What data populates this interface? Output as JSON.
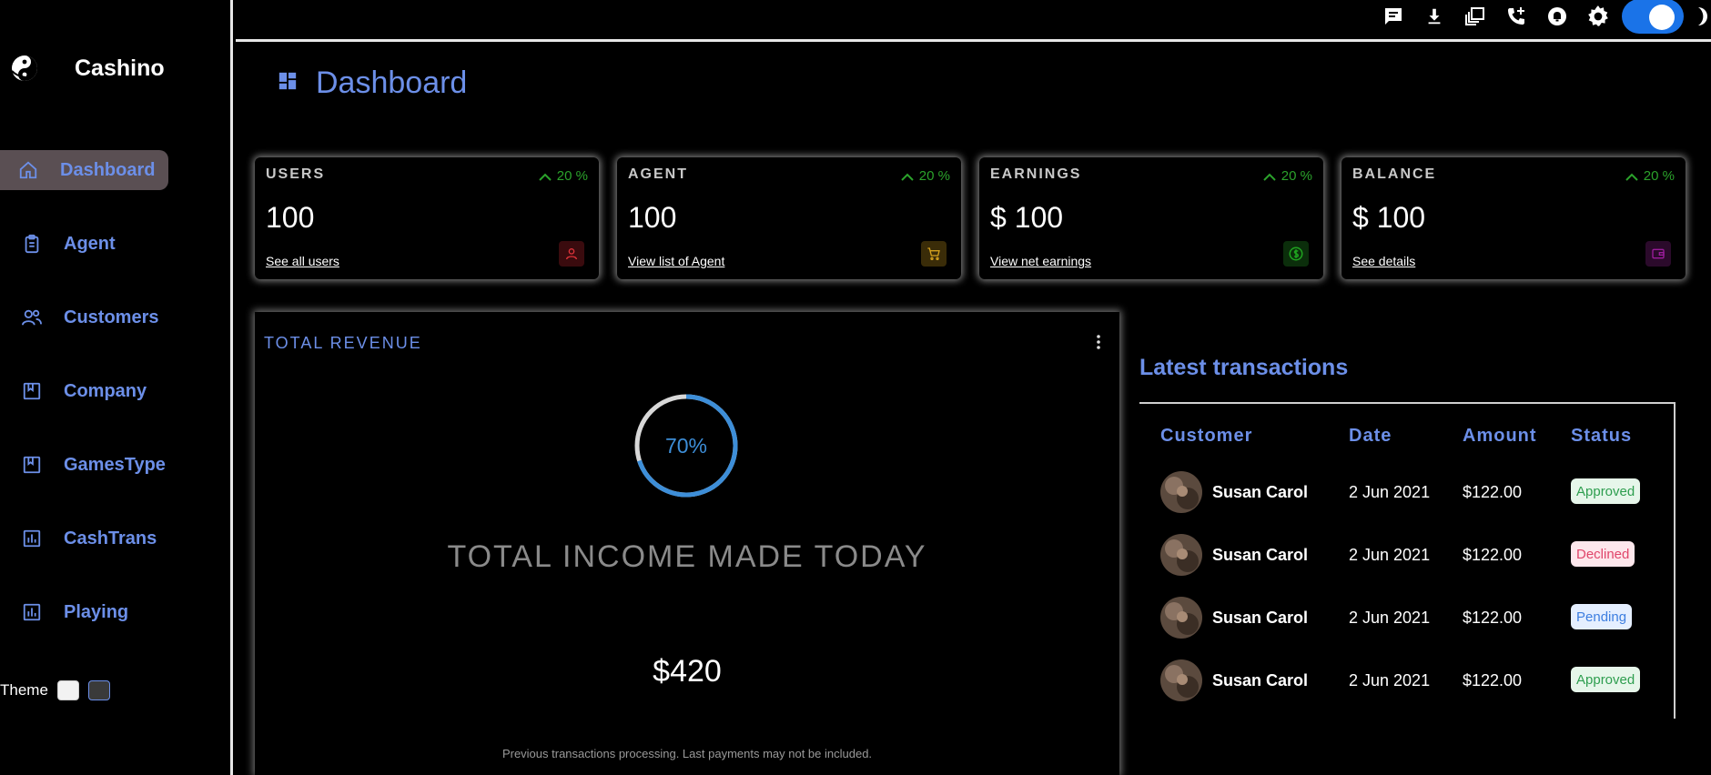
{
  "app": {
    "logo_text": "Cashino"
  },
  "sidebar": {
    "items": [
      {
        "label": "Dashboard",
        "icon": "home-icon"
      },
      {
        "label": "Agent",
        "icon": "clipboard-icon"
      },
      {
        "label": "Customers",
        "icon": "users-icon"
      },
      {
        "label": "Company",
        "icon": "bookmark-icon"
      },
      {
        "label": "GamesType",
        "icon": "bookmark-icon"
      },
      {
        "label": "CashTrans",
        "icon": "bar-chart-icon"
      },
      {
        "label": "Playing",
        "icon": "bar-chart-icon"
      }
    ],
    "theme_label": "Theme",
    "theme_swatches": [
      "#f2f2f2",
      "#3a3a3a"
    ]
  },
  "topbar": {
    "icons": [
      "chat-icon",
      "download-icon",
      "copy-icon",
      "add-call-icon",
      "notification-icon",
      "settings-icon"
    ],
    "toggle_on": true
  },
  "page": {
    "title": "Dashboard"
  },
  "cards": [
    {
      "title": "USERS",
      "trend": "20 %",
      "value": "100",
      "link": "See all users",
      "badge_icon": "person-icon",
      "badge_color": "#e0333a"
    },
    {
      "title": "AGENT",
      "trend": "20 %",
      "value": "100",
      "link": "View list of Agent",
      "badge_icon": "cart-icon",
      "badge_color": "#d4a11e"
    },
    {
      "title": "EARNINGS",
      "trend": "20 %",
      "value": "$ 100",
      "link": "View net earnings",
      "badge_icon": "dollar-icon",
      "badge_color": "#1fa31f"
    },
    {
      "title": "BALANCE",
      "trend": "20 %",
      "value": "$ 100",
      "link": "See details",
      "badge_icon": "wallet-icon",
      "badge_color": "#9b1d9b"
    }
  ],
  "revenue": {
    "title": "TOTAL REVENUE",
    "progress_label": "70%",
    "progress": 0.7,
    "income_label": "TOTAL INCOME MADE TODAY",
    "income_value": "$420",
    "note": "Previous transactions processing. Last payments may not be included."
  },
  "transactions": {
    "title": "Latest transactions",
    "headers": {
      "customer": "Customer",
      "date": "Date",
      "amount": "Amount",
      "status": "Status"
    },
    "rows": [
      {
        "customer": "Susan Carol",
        "date": "2 Jun 2021",
        "amount": "$122.00",
        "status": "Approved"
      },
      {
        "customer": "Susan Carol",
        "date": "2 Jun 2021",
        "amount": "$122.00",
        "status": "Declined"
      },
      {
        "customer": "Susan Carol",
        "date": "2 Jun 2021",
        "amount": "$122.00",
        "status": "Pending"
      },
      {
        "customer": "Susan Carol",
        "date": "2 Jun 2021",
        "amount": "$122.00",
        "status": "Approved"
      }
    ],
    "status_colors": {
      "Approved": {
        "fg": "#2e9e4f",
        "bg": "#e6f6ea"
      },
      "Declined": {
        "fg": "#e0456a",
        "bg": "#fde7ec"
      },
      "Pending": {
        "fg": "#3d7ee0",
        "bg": "#e5efff"
      }
    }
  }
}
